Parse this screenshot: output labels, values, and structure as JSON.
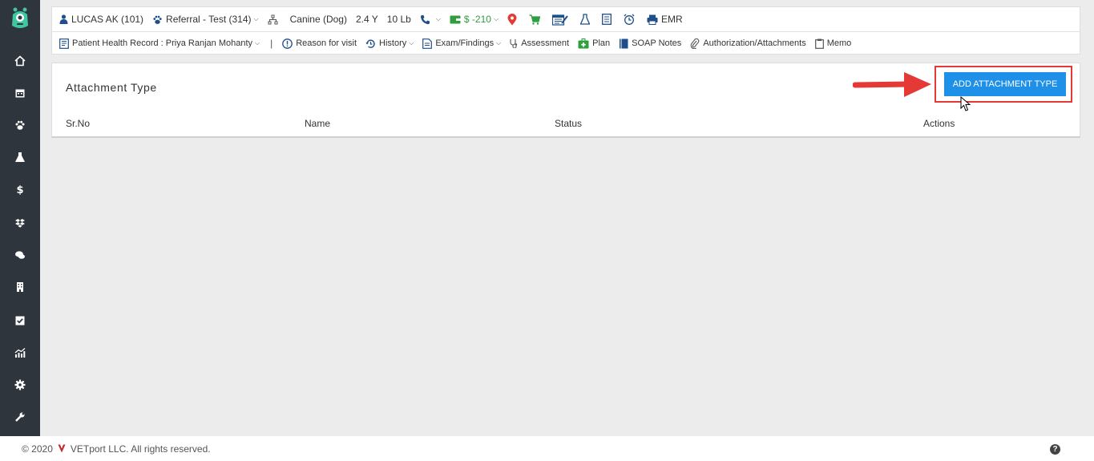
{
  "header": {
    "patient": "LUCAS AK (101)",
    "referral": "Referral - Test (314)",
    "species": "Canine (Dog)",
    "age": "2.4 Y",
    "weight": "10 Lb",
    "balance": "$ -210",
    "emr": "EMR"
  },
  "nav": {
    "phr": "Patient Health Record : Priya Ranjan Mohanty",
    "separator": "|",
    "reason": "Reason for visit",
    "history": "History",
    "exam": "Exam/Findings",
    "assessment": "Assessment",
    "plan": "Plan",
    "soap": "SOAP Notes",
    "auth": "Authorization/Attachments",
    "memo": "Memo"
  },
  "card": {
    "title": "Attachment Type",
    "add_button": "ADD ATTACHMENT TYPE",
    "columns": [
      "Sr.No",
      "Name",
      "Status",
      "Actions"
    ]
  },
  "footer": {
    "copyright": "© 2020",
    "company": "VETport LLC. All rights reserved.",
    "help": "?"
  },
  "colors": {
    "sidebar": "#2f353d",
    "accent": "#1e90e8",
    "highlight": "#e53935",
    "logo": "#3ec7a1"
  }
}
